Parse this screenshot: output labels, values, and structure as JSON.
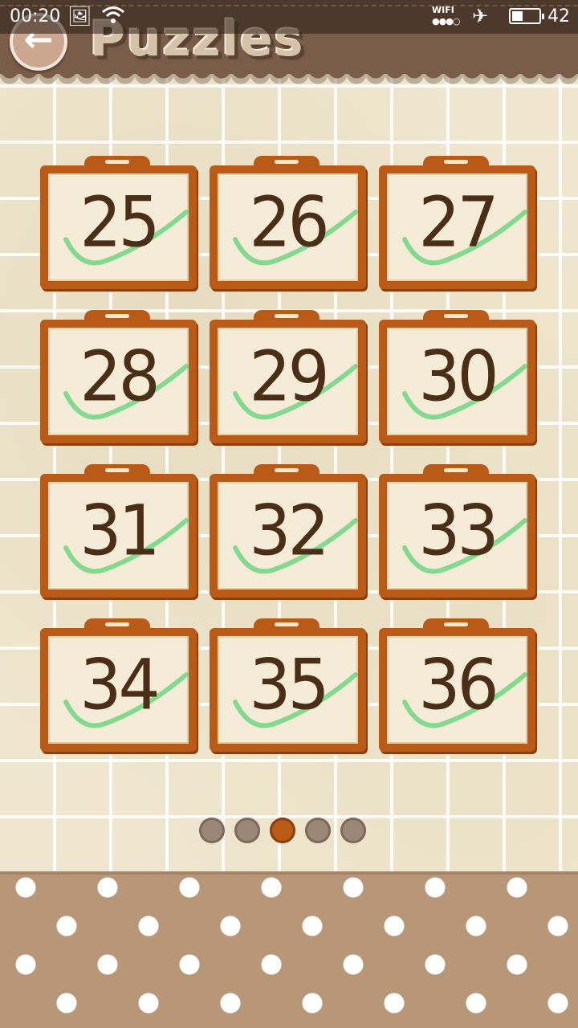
{
  "status_bar": {
    "time": "00:20",
    "wifi_label": "WIFI",
    "battery_level": "42",
    "battery_fraction": 0.42
  },
  "header": {
    "title": "Puzzles",
    "back_icon": "back-arrow-icon"
  },
  "puzzles": [
    {
      "number": "25",
      "solved": true
    },
    {
      "number": "26",
      "solved": true
    },
    {
      "number": "27",
      "solved": true
    },
    {
      "number": "28",
      "solved": true
    },
    {
      "number": "29",
      "solved": true
    },
    {
      "number": "30",
      "solved": true
    },
    {
      "number": "31",
      "solved": true
    },
    {
      "number": "32",
      "solved": true
    },
    {
      "number": "33",
      "solved": true
    },
    {
      "number": "34",
      "solved": true
    },
    {
      "number": "35",
      "solved": true
    },
    {
      "number": "36",
      "solved": true
    }
  ],
  "pagination": {
    "total_pages": 5,
    "current_page": 3
  },
  "colors": {
    "board": "#b95a17",
    "check": "#5fd37a",
    "number": "#4a2e18",
    "header": "#7a5d48"
  }
}
